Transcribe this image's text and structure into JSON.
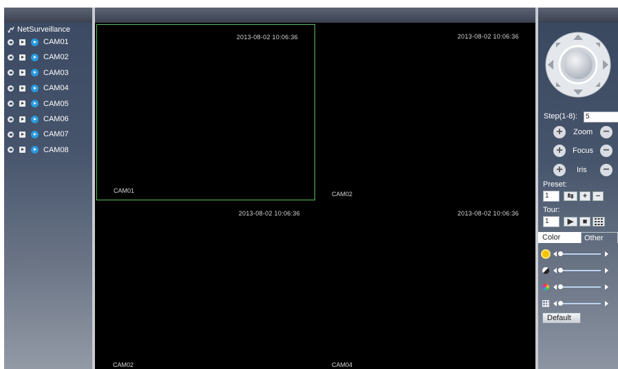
{
  "tree": {
    "root_label": "NetSurveillance",
    "cameras": [
      "CAM01",
      "CAM02",
      "CAM03",
      "CAM04",
      "CAM05",
      "CAM06",
      "CAM07",
      "CAM08"
    ]
  },
  "video": {
    "tiles": [
      {
        "timestamp": "2013-08-02 10:06:36",
        "label": "CAM01"
      },
      {
        "timestamp": "2013-08-02 10:06:36",
        "label": "CAM02"
      },
      {
        "timestamp": "2013-08-02 10:06:36",
        "label": "CAM02"
      },
      {
        "timestamp": "2013-08-02 10:06:36",
        "label": "CAM04"
      }
    ]
  },
  "ptz": {
    "step_label": "Step(1-8):",
    "step_value": "5",
    "zoom_label": "Zoom",
    "focus_label": "Focus",
    "iris_label": "Iris",
    "preset_label": "Preset:",
    "preset_value": "1",
    "tour_label": "Tour:",
    "tour_value": "1"
  },
  "color_panel": {
    "tab_color": "Color",
    "tab_other": "Other",
    "default_label": "Default",
    "sliders": [
      "brightness-icon",
      "contrast-icon",
      "saturation-icon",
      "hue-icon"
    ]
  },
  "colors": {
    "selected_border": "#5fc15f",
    "live_icon": "#2a9be0"
  }
}
